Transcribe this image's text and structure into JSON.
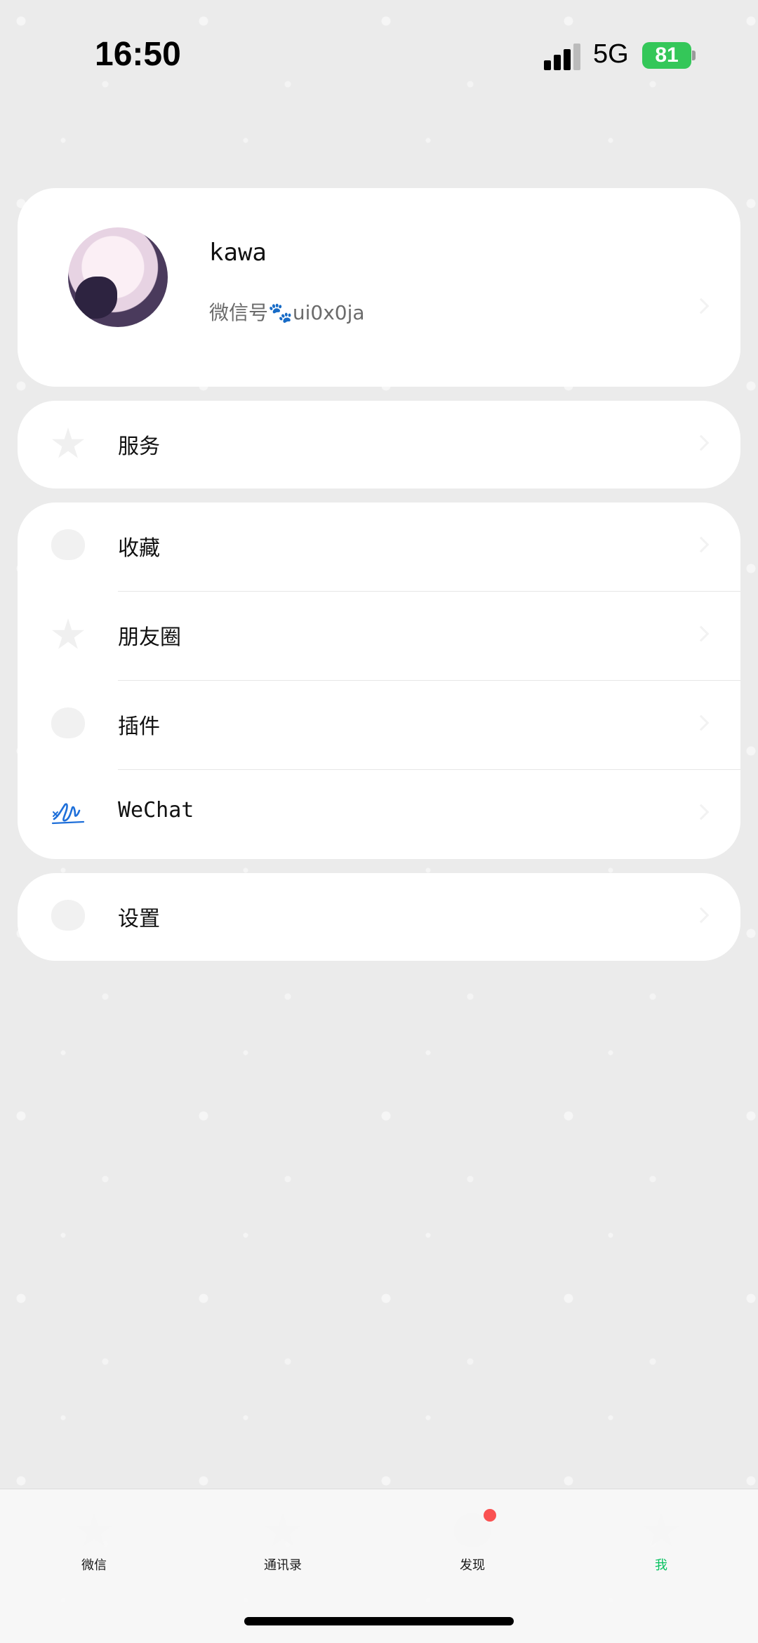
{
  "status_bar": {
    "time": "16:50",
    "network": "5G",
    "battery": "81"
  },
  "profile": {
    "name": "kawa",
    "wechat_id": "微信号🐾ui0x0ja"
  },
  "services": {
    "label": "服务",
    "icon": "star-icon"
  },
  "menu": [
    {
      "label": "收藏",
      "icon": "heart-icon"
    },
    {
      "label": "朋友圈",
      "icon": "star-icon"
    },
    {
      "label": "插件",
      "icon": "heart-icon"
    },
    {
      "label": "WeChat",
      "icon": "wechat-signature-icon"
    }
  ],
  "settings": {
    "label": "设置",
    "icon": "heart-icon"
  },
  "tabs": [
    {
      "label": "微信",
      "icon": "star-icon"
    },
    {
      "label": "通讯录",
      "icon": "star-icon"
    },
    {
      "label": "发现",
      "icon": "heart-icon"
    },
    {
      "label": "我",
      "icon": "star-icon"
    }
  ],
  "colors": {
    "accent": "#07c160",
    "badge": "#fa5151",
    "battery": "#34c759",
    "signature": "#1e6fd9"
  }
}
